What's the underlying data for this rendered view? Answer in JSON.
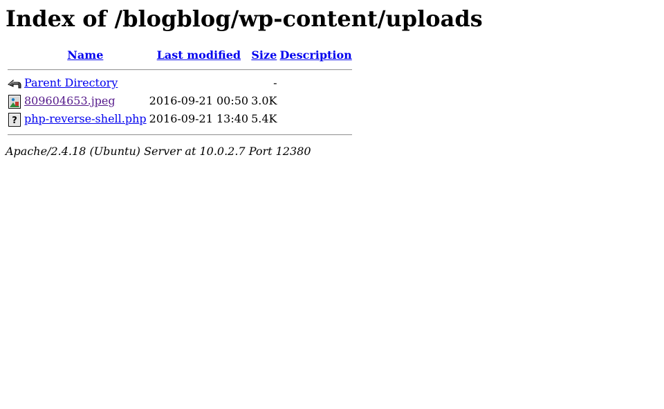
{
  "page": {
    "title": "Index of /blogblog/wp-content/uploads"
  },
  "table": {
    "headers": {
      "name": "Name",
      "last_modified": "Last modified",
      "size": "Size",
      "description": "Description"
    },
    "rows": [
      {
        "icon": "back-icon",
        "name": "Parent Directory",
        "last_modified": "",
        "size": "-",
        "description": "",
        "visited": false
      },
      {
        "icon": "image-file-icon",
        "name": "809604653.jpeg",
        "last_modified": "2016-09-21 00:50",
        "size": "3.0K",
        "description": "",
        "visited": true
      },
      {
        "icon": "unknown-file-icon",
        "name": "php-reverse-shell.php",
        "last_modified": "2016-09-21 13:40",
        "size": "5.4K",
        "description": "",
        "visited": false
      }
    ]
  },
  "footer": {
    "address": "Apache/2.4.18 (Ubuntu) Server at 10.0.2.7 Port 12380"
  },
  "colors": {
    "link": "#0000ee",
    "visited_link": "#551a8b"
  }
}
